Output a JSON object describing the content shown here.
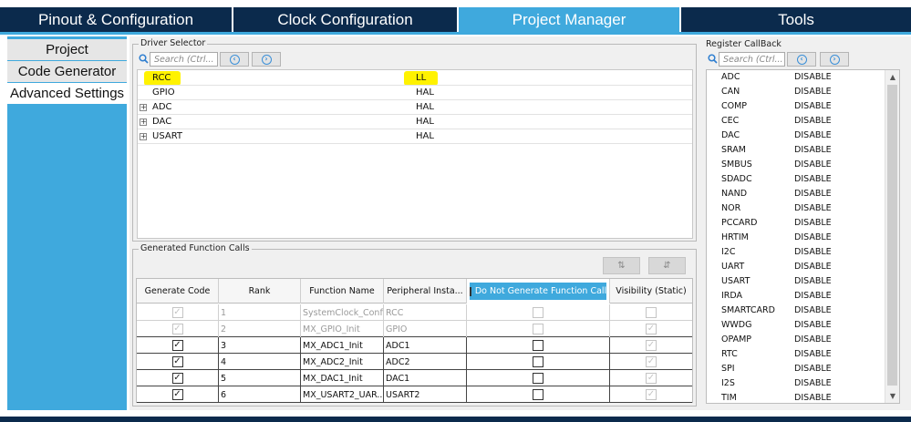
{
  "top_tabs": [
    {
      "label": "Pinout & Configuration",
      "active": false
    },
    {
      "label": "Clock Configuration",
      "active": false
    },
    {
      "label": "Project Manager",
      "active": true
    },
    {
      "label": "Tools",
      "active": false
    }
  ],
  "left_nav": [
    {
      "label": "Project",
      "active": false
    },
    {
      "label": "Code Generator",
      "active": false
    },
    {
      "label": "Advanced Settings",
      "active": true
    }
  ],
  "driver_selector": {
    "title": "Driver Selector",
    "search_placeholder": "Search (Ctrl...",
    "rows": [
      {
        "name": "RCC",
        "value": "LL",
        "expandable": false,
        "highlighted": true
      },
      {
        "name": "GPIO",
        "value": "HAL",
        "expandable": false,
        "highlighted": false
      },
      {
        "name": "ADC",
        "value": "HAL",
        "expandable": true,
        "highlighted": false
      },
      {
        "name": "DAC",
        "value": "HAL",
        "expandable": true,
        "highlighted": false
      },
      {
        "name": "USART",
        "value": "HAL",
        "expandable": true,
        "highlighted": false
      }
    ]
  },
  "generated_function_calls": {
    "title": "Generated Function Calls",
    "columns": [
      "Generate Code",
      "Rank",
      "Function Name",
      "Peripheral Insta...",
      "Do Not Generate Function Call",
      "Visibility (Static)"
    ],
    "rows": [
      {
        "generate": true,
        "generate_enabled": false,
        "rank": "1",
        "function": "SystemClock_Config",
        "peripheral": "RCC",
        "do_not_generate": false,
        "dng_enabled": false,
        "visibility": false,
        "vis_enabled": false,
        "row_enabled": false
      },
      {
        "generate": true,
        "generate_enabled": false,
        "rank": "2",
        "function": "MX_GPIO_Init",
        "peripheral": "GPIO",
        "do_not_generate": false,
        "dng_enabled": false,
        "visibility": true,
        "vis_enabled": false,
        "row_enabled": false
      },
      {
        "generate": true,
        "generate_enabled": true,
        "rank": "3",
        "function": "MX_ADC1_Init",
        "peripheral": "ADC1",
        "do_not_generate": false,
        "dng_enabled": true,
        "visibility": true,
        "vis_enabled": false,
        "row_enabled": true
      },
      {
        "generate": true,
        "generate_enabled": true,
        "rank": "4",
        "function": "MX_ADC2_Init",
        "peripheral": "ADC2",
        "do_not_generate": false,
        "dng_enabled": true,
        "visibility": true,
        "vis_enabled": false,
        "row_enabled": true
      },
      {
        "generate": true,
        "generate_enabled": true,
        "rank": "5",
        "function": "MX_DAC1_Init",
        "peripheral": "DAC1",
        "do_not_generate": false,
        "dng_enabled": true,
        "visibility": true,
        "vis_enabled": false,
        "row_enabled": true
      },
      {
        "generate": true,
        "generate_enabled": true,
        "rank": "6",
        "function": "MX_USART2_UAR...",
        "peripheral": "USART2",
        "do_not_generate": false,
        "dng_enabled": true,
        "visibility": true,
        "vis_enabled": false,
        "row_enabled": true
      }
    ]
  },
  "register_callback": {
    "title": "Register CallBack",
    "search_placeholder": "Search (Ctrl...",
    "rows": [
      {
        "name": "ADC",
        "value": "DISABLE"
      },
      {
        "name": "CAN",
        "value": "DISABLE"
      },
      {
        "name": "COMP",
        "value": "DISABLE"
      },
      {
        "name": "CEC",
        "value": "DISABLE"
      },
      {
        "name": "DAC",
        "value": "DISABLE"
      },
      {
        "name": "SRAM",
        "value": "DISABLE"
      },
      {
        "name": "SMBUS",
        "value": "DISABLE"
      },
      {
        "name": "SDADC",
        "value": "DISABLE"
      },
      {
        "name": "NAND",
        "value": "DISABLE"
      },
      {
        "name": "NOR",
        "value": "DISABLE"
      },
      {
        "name": "PCCARD",
        "value": "DISABLE"
      },
      {
        "name": "HRTIM",
        "value": "DISABLE"
      },
      {
        "name": "I2C",
        "value": "DISABLE"
      },
      {
        "name": "UART",
        "value": "DISABLE"
      },
      {
        "name": "USART",
        "value": "DISABLE"
      },
      {
        "name": "IRDA",
        "value": "DISABLE"
      },
      {
        "name": "SMARTCARD",
        "value": "DISABLE"
      },
      {
        "name": "WWDG",
        "value": "DISABLE"
      },
      {
        "name": "OPAMP",
        "value": "DISABLE"
      },
      {
        "name": "RTC",
        "value": "DISABLE"
      },
      {
        "name": "SPI",
        "value": "DISABLE"
      },
      {
        "name": "I2S",
        "value": "DISABLE"
      },
      {
        "name": "TIM",
        "value": "DISABLE"
      }
    ]
  },
  "icons": {
    "search": "search-icon",
    "prev": "circle-left-arrow-icon",
    "next": "circle-right-arrow-icon",
    "sort_up": "sort-up-icon",
    "sort_down": "sort-down-icon"
  },
  "colors": {
    "navy": "#0b2a4c",
    "accent": "#3fa9dd",
    "highlight": "#fff200"
  }
}
